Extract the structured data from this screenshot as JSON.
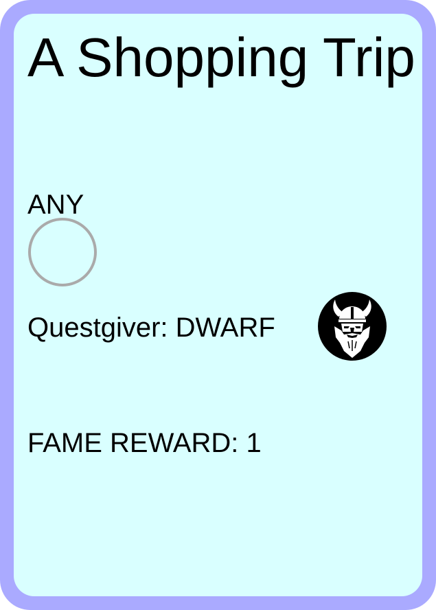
{
  "card": {
    "title": "A Shopping Trip",
    "requirement_label": "ANY",
    "questgiver_label": "Questgiver: DWARF",
    "questgiver_icon": "dwarf-viking-icon",
    "reward_label": "FAME REWARD: 1"
  },
  "colors": {
    "border": "#aaaaff",
    "background": "#d9ffff",
    "slot_ring": "#aaaaaa",
    "icon": "#000000"
  }
}
